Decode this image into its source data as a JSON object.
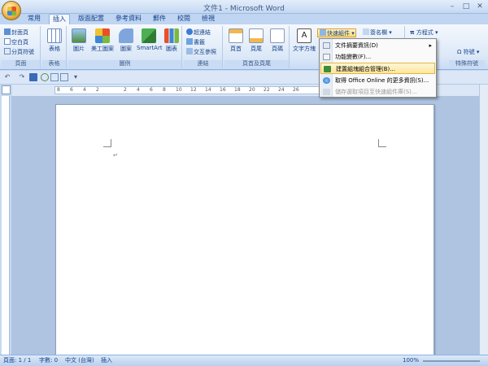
{
  "window": {
    "title": "文件1 - Microsoft Word",
    "minimize": "–",
    "maximize": "□",
    "close": "✕"
  },
  "tabs": [
    {
      "label": "常用"
    },
    {
      "label": "插入"
    },
    {
      "label": "版面配置"
    },
    {
      "label": "參考資料"
    },
    {
      "label": "郵件"
    },
    {
      "label": "校閱"
    },
    {
      "label": "檢視"
    }
  ],
  "ribbon": {
    "pages": {
      "label": "頁面",
      "cover": "封面頁",
      "blank": "空白頁",
      "break": "分頁符號"
    },
    "tables": {
      "label": "表格",
      "table": "表格"
    },
    "illustrations": {
      "label": "圖例",
      "picture": "圖片",
      "clipart": "美工圖案",
      "shapes": "圖案",
      "smartart": "SmartArt",
      "chart": "圖表"
    },
    "links": {
      "label": "連結",
      "hyperlink": "超連結",
      "bookmark": "書籤",
      "crossref": "交互參照"
    },
    "header_footer": {
      "label": "頁首及頁尾",
      "header": "頁首",
      "footer": "頁尾",
      "pagenum": "頁碼"
    },
    "text": {
      "textbox": "文字方塊",
      "quickparts": "快速組件",
      "signature": "簽名欄"
    },
    "symbols": {
      "label": "特殊符號",
      "equation": "方程式",
      "symbol": "符號"
    }
  },
  "dropdown": [
    {
      "label": "文件摘要資訊(D)",
      "arrow": "▸"
    },
    {
      "label": "功能變數(F)..."
    },
    {
      "label": "建置組塊組合管理(B)..."
    },
    {
      "label": "取得 Office Online 的更多資訊(S)..."
    },
    {
      "label": "儲存選取項目至快速組件庫(S)..."
    }
  ],
  "statusbar": {
    "page": "頁面: 1 / 1",
    "words": "字數: 0",
    "lang": "中文 (台灣)",
    "mode": "插入",
    "zoom": "100%"
  },
  "ruler_marks": [
    "8",
    "6",
    "4",
    "2",
    "2",
    "4",
    "6",
    "8",
    "10",
    "12",
    "14",
    "16",
    "18",
    "20",
    "22",
    "24",
    "26"
  ],
  "colors": {
    "accent": "#15428b",
    "highlight": "#ffe69a"
  }
}
